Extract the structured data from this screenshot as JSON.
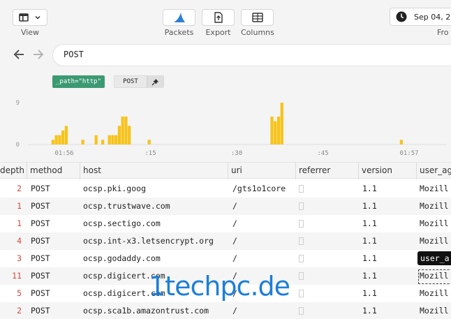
{
  "toolbar": {
    "view_label": "View",
    "packets_label": "Packets",
    "export_label": "Export",
    "columns_label": "Columns",
    "date_text": "Sep 04, 20",
    "from_label": "Fro"
  },
  "nav": {
    "back_icon": "arrow-left-icon",
    "forward_icon": "arrow-right-icon"
  },
  "search": {
    "value": "POST"
  },
  "filters": {
    "path_chip": "_path=\"http\"",
    "post_chip": "POST",
    "pin_icon": "pin-icon"
  },
  "chart_data": {
    "type": "bar",
    "ylim": [
      0,
      9
    ],
    "y_ticks": [
      "9",
      "0"
    ],
    "x_ticks": [
      "01:56",
      ":15",
      ":30",
      ":45",
      "01:57"
    ],
    "bar_color": "#f7c31b",
    "values": [
      0,
      0,
      0,
      0,
      0,
      1,
      2,
      2,
      3,
      4,
      0,
      0,
      0,
      0,
      1,
      0,
      0,
      0,
      2,
      0,
      1,
      0,
      2,
      2,
      2,
      4,
      6,
      6,
      4,
      0,
      0,
      0,
      0,
      0,
      1,
      0,
      0,
      0,
      0,
      0,
      0,
      0,
      0,
      0,
      0,
      0,
      0,
      0,
      0,
      0,
      0,
      0,
      0,
      0,
      0,
      0,
      0,
      0,
      0,
      0,
      0,
      0,
      0,
      0,
      0,
      0,
      0,
      0,
      0,
      0,
      0,
      6,
      5,
      6,
      9,
      0,
      0,
      0,
      0,
      0,
      0,
      0,
      0,
      0,
      0,
      0,
      0,
      0,
      0,
      0,
      0,
      0,
      0,
      0,
      0,
      0,
      0,
      0,
      0,
      0,
      0,
      0,
      0,
      0,
      0,
      0,
      0,
      0,
      0,
      0,
      1,
      0,
      0,
      0,
      0,
      0,
      0,
      0,
      0,
      0,
      0
    ]
  },
  "table": {
    "columns": [
      "depth",
      "method",
      "host",
      "uri",
      "referrer",
      "version",
      "user_ag"
    ],
    "rows": [
      {
        "depth": "2",
        "method": "POST",
        "host": "ocsp.pki.goog",
        "uri": "/gts1o1core",
        "version": "1.1",
        "user_agent": "Mozill"
      },
      {
        "depth": "1",
        "method": "POST",
        "host": "ocsp.trustwave.com",
        "uri": "/",
        "version": "1.1",
        "user_agent": "Mozill"
      },
      {
        "depth": "1",
        "method": "POST",
        "host": "ocsp.sectigo.com",
        "uri": "/",
        "version": "1.1",
        "user_agent": "Mozill"
      },
      {
        "depth": "4",
        "method": "POST",
        "host": "ocsp.int-x3.letsencrypt.org",
        "uri": "/",
        "version": "1.1",
        "user_agent": "Mozill"
      },
      {
        "depth": "3",
        "method": "POST",
        "host": "ocsp.godaddy.com",
        "uri": "/",
        "version": "1.1",
        "user_agent": ""
      },
      {
        "depth": "11",
        "method": "POST",
        "host": "ocsp.digicert.com",
        "uri": "/",
        "version": "1.1",
        "user_agent": "Mozill"
      },
      {
        "depth": "5",
        "method": "POST",
        "host": "ocsp.digicert.com",
        "uri": "/",
        "version": "1.1",
        "user_agent": "Mozill"
      },
      {
        "depth": "2",
        "method": "POST",
        "host": "ocsp.sca1b.amazontrust.com",
        "uri": "/",
        "version": "1.1",
        "user_agent": "Mozill"
      }
    ]
  },
  "tooltip": {
    "text": "user_a"
  },
  "watermark": {
    "text": "1techpc.de"
  }
}
